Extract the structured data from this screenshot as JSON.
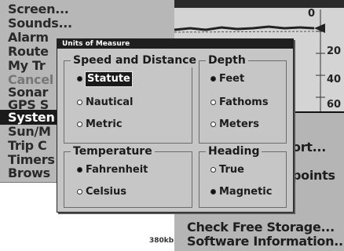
{
  "main_menu": {
    "items": [
      {
        "label": "Screen..."
      },
      {
        "label": "Sounds..."
      },
      {
        "label": "Alarm"
      },
      {
        "label": "Route"
      },
      {
        "label": "My Tr"
      },
      {
        "label": "Cancel"
      },
      {
        "label": "Sonar"
      },
      {
        "label": "GPS S"
      },
      {
        "label": "Systen"
      },
      {
        "label": "Sun/M"
      },
      {
        "label": "Trip C"
      },
      {
        "label": "Timers"
      },
      {
        "label": "Brows"
      }
    ]
  },
  "sonar": {
    "depth_labels": [
      "0",
      "20",
      "40",
      "60"
    ]
  },
  "sub_menu": {
    "items": [
      {
        "label": "ort..."
      },
      {
        "label": "points"
      },
      {
        "label": "Check Free Storage..."
      },
      {
        "label": "Software Information..."
      }
    ]
  },
  "corner_tag": "380kb",
  "dialog": {
    "title": "Units of Measure",
    "speed": {
      "title": "Speed and Distance",
      "options": [
        {
          "label": "Statute",
          "selected": true
        },
        {
          "label": "Nautical",
          "selected": false
        },
        {
          "label": "Metric",
          "selected": false
        }
      ]
    },
    "depth": {
      "title": "Depth",
      "options": [
        {
          "label": "Feet",
          "selected": true
        },
        {
          "label": "Fathoms",
          "selected": false
        },
        {
          "label": "Meters",
          "selected": false
        }
      ]
    },
    "temperature": {
      "title": "Temperature",
      "options": [
        {
          "label": "Fahrenheit",
          "selected": true
        },
        {
          "label": "Celsius",
          "selected": false
        }
      ]
    },
    "heading": {
      "title": "Heading",
      "options": [
        {
          "label": "True",
          "selected": false
        },
        {
          "label": "Magnetic",
          "selected": true
        }
      ]
    }
  },
  "colors": {
    "highlight": "#1a1a1a",
    "panel": "#c6c6c6",
    "menu_bg": "#b7b7b7"
  }
}
